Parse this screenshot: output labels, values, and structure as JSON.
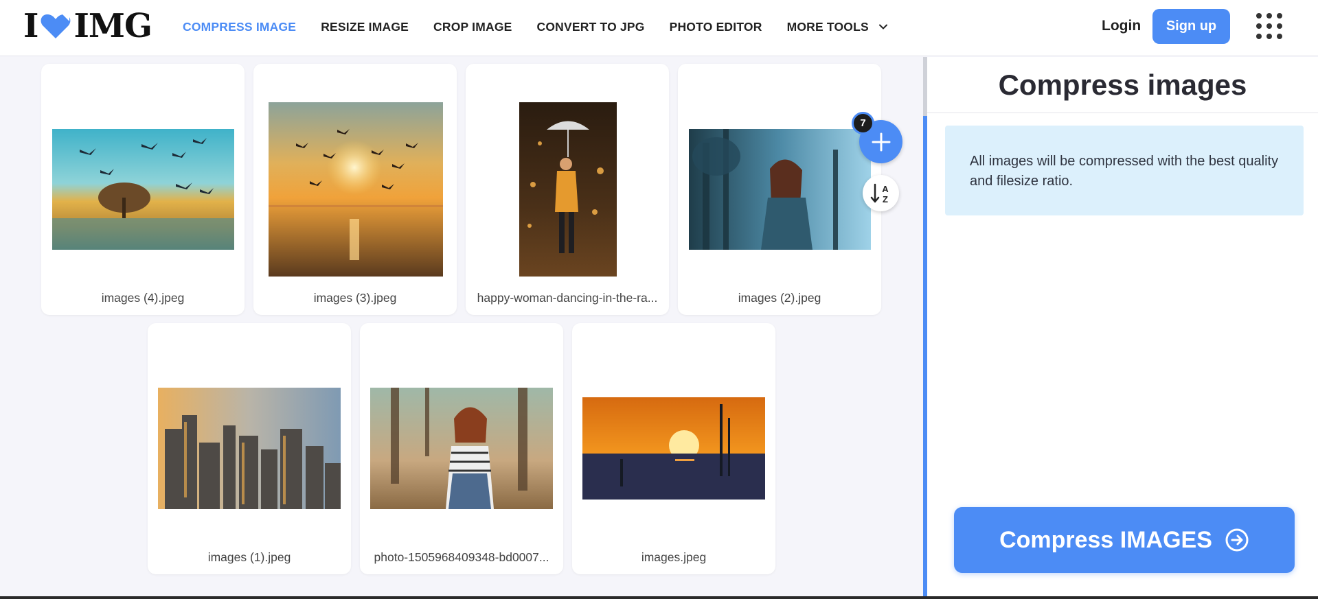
{
  "header": {
    "logo_left": "I",
    "logo_right": "IMG",
    "nav": [
      {
        "label": "COMPRESS IMAGE",
        "active": true
      },
      {
        "label": "RESIZE IMAGE"
      },
      {
        "label": "CROP IMAGE"
      },
      {
        "label": "CONVERT TO JPG"
      },
      {
        "label": "PHOTO EDITOR"
      },
      {
        "label": "MORE TOOLS",
        "icon": "chevron-down-icon"
      }
    ],
    "login": "Login",
    "signup": "Sign up",
    "apps_icon": "grid-menu-icon"
  },
  "workspace": {
    "files": [
      {
        "name": "images (4).jpeg"
      },
      {
        "name": "images (3).jpeg"
      },
      {
        "name": "happy-woman-dancing-in-the-ra..."
      },
      {
        "name": "images (2).jpeg"
      },
      {
        "name": "images (1).jpeg"
      },
      {
        "name": "photo-1505968409348-bd0007..."
      },
      {
        "name": "images.jpeg"
      }
    ],
    "add_badge": "7",
    "add_icon": "plus-icon",
    "sort_icon": "sort-alpha-icon",
    "sort_letters": [
      "A",
      "Z"
    ]
  },
  "sidebar": {
    "title": "Compress images",
    "info": "All images will be compressed with the best quality and filesize ratio.",
    "action": "Compress IMAGES",
    "action_icon": "arrow-circle-right-icon"
  },
  "colors": {
    "accent": "#4c8cf5",
    "info_bg": "#dcf0fc",
    "workspace_bg": "#f5f5fa"
  }
}
